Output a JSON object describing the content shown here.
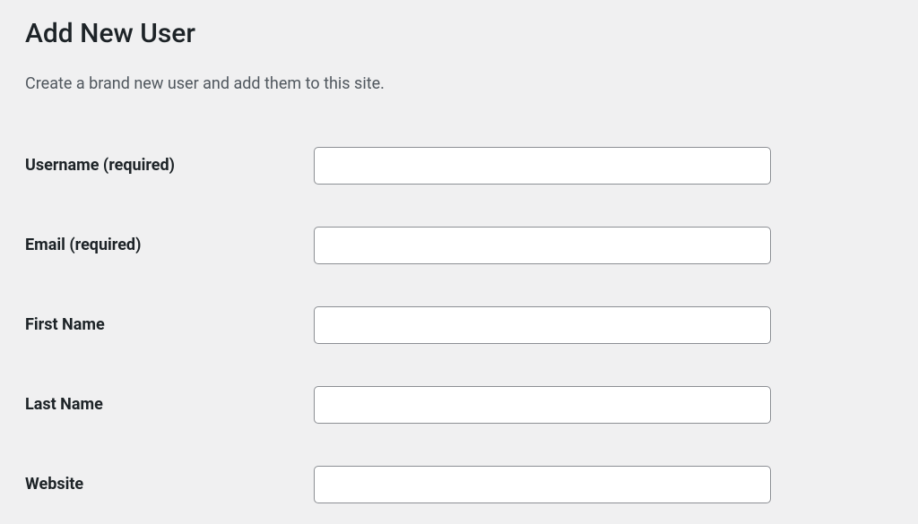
{
  "page": {
    "title": "Add New User",
    "description": "Create a brand new user and add them to this site."
  },
  "form": {
    "fields": [
      {
        "label": "Username (required)",
        "value": "",
        "type": "text"
      },
      {
        "label": "Email (required)",
        "value": "",
        "type": "email"
      },
      {
        "label": "First Name",
        "value": "",
        "type": "text"
      },
      {
        "label": "Last Name",
        "value": "",
        "type": "text"
      },
      {
        "label": "Website",
        "value": "",
        "type": "url"
      }
    ]
  }
}
